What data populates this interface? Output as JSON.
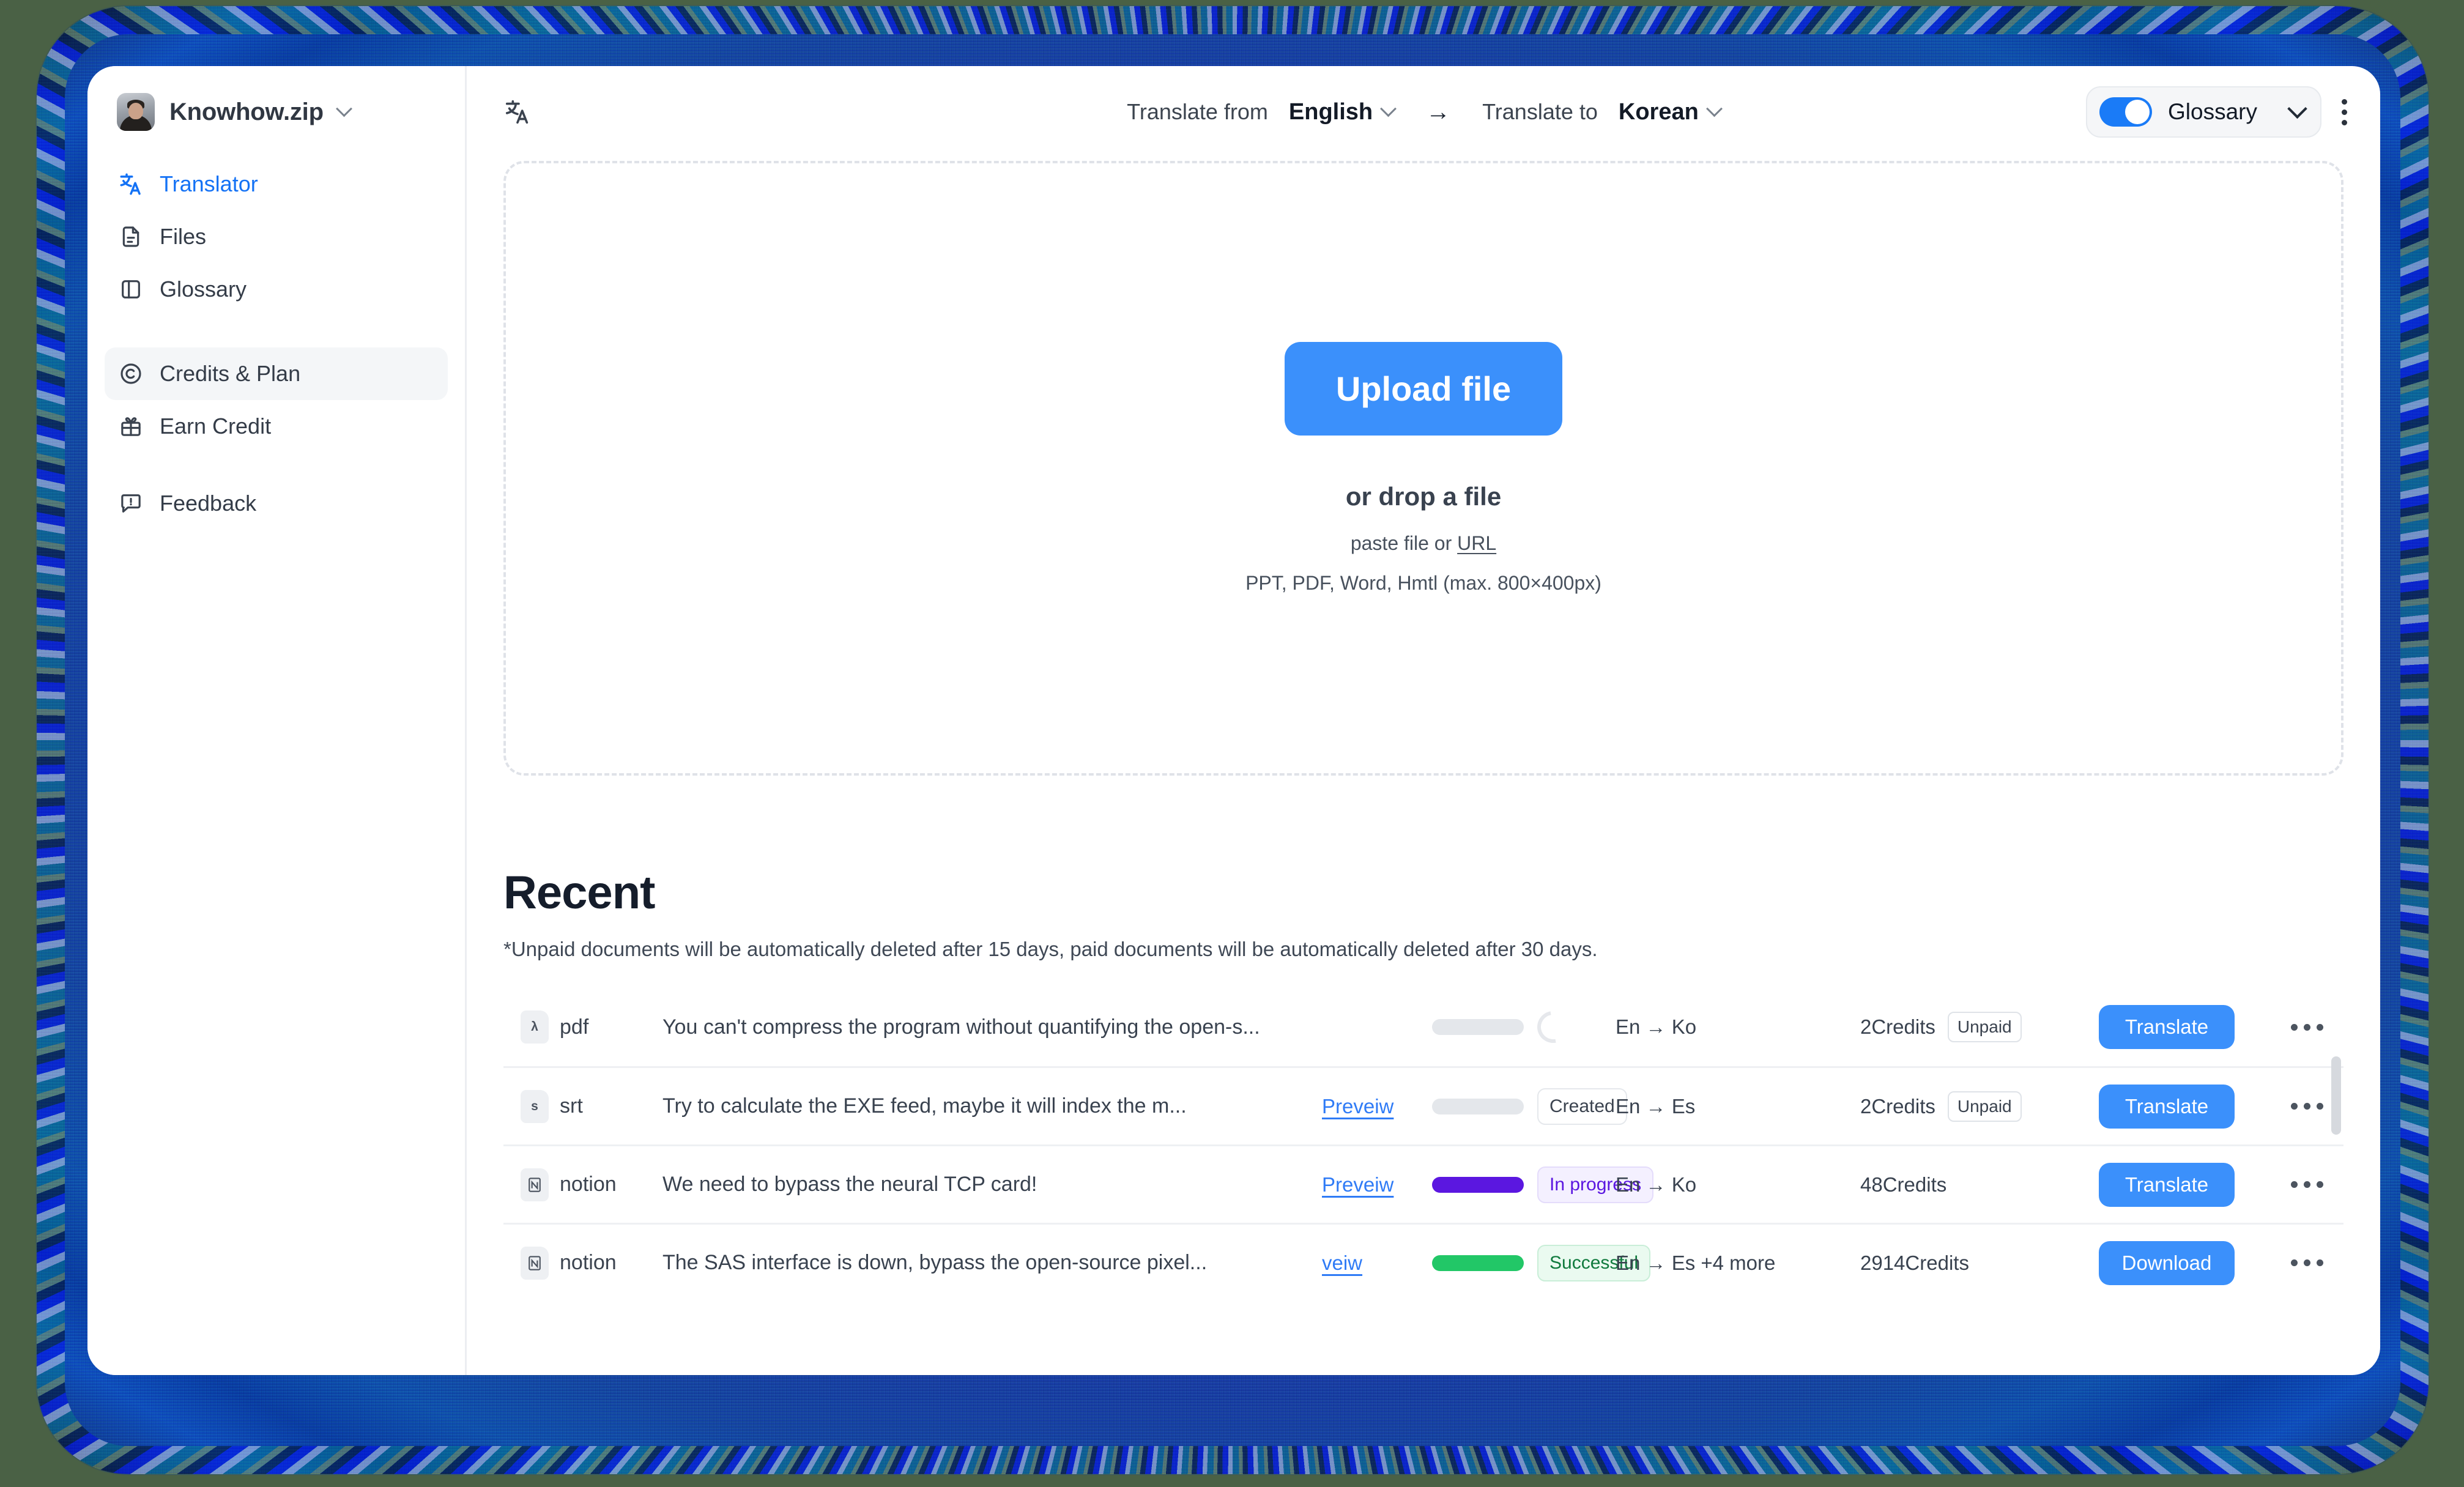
{
  "window": {
    "frame_color": "#1b3f9e"
  },
  "sidebar": {
    "brand": {
      "name": "Knowhow.zip",
      "chevron_icon": "chevron-down-icon",
      "avatar_icon": "user-avatar"
    },
    "items": [
      {
        "label": "Translator",
        "icon": "translate-icon",
        "state": "active"
      },
      {
        "label": "Files",
        "icon": "file-icon",
        "state": "default"
      },
      {
        "label": "Glossary",
        "icon": "book-panel-icon",
        "state": "default"
      },
      {
        "label": "Credits & Plan",
        "icon": "copyright-icon",
        "state": "selected"
      },
      {
        "label": "Earn Credit",
        "icon": "gift-icon",
        "state": "default"
      },
      {
        "label": "Feedback",
        "icon": "feedback-icon",
        "state": "default"
      }
    ]
  },
  "topbar": {
    "app_icon": "translate-icon",
    "translate_from_label": "Translate from",
    "source_language": "English",
    "direction_arrow": "→",
    "translate_to_label": "Translate to",
    "target_language": "Korean",
    "glossary_label": "Glossary",
    "glossary_enabled": true,
    "glossary_chevron_icon": "chevron-down-icon",
    "kebab_icon": "kebab-menu-icon",
    "accent_color": "#1a7bf7"
  },
  "dropzone": {
    "upload_button": "Upload file",
    "title": "or drop a file",
    "paste_prefix": "paste file or ",
    "paste_link": "URL",
    "formats": "PPT, PDF, Word, Hmtl (max. 800×400px)"
  },
  "recent": {
    "title": "Recent",
    "note": "*Unpaid documents will be automatically deleted after 15 days, paid documents will be automatically deleted after 30 days.",
    "rows": [
      {
        "type": "pdf",
        "type_glyph": "λ",
        "name": "You can't compress the program without quantifying the open-s...",
        "preview": "",
        "progress_pct": 0,
        "progress_color": "#e4e7eb",
        "spinner": true,
        "status": "",
        "status_kind": "none",
        "langs": "En → Ko",
        "credits": "2Credits",
        "payment": "Unpaid",
        "action": "Translate",
        "more_icon": "more-horizontal-icon"
      },
      {
        "type": "srt",
        "type_glyph": "s",
        "name": "Try to calculate the EXE feed, maybe it will index the m...",
        "preview": "Preveiw",
        "progress_pct": 0,
        "progress_color": "#e4e7eb",
        "spinner": false,
        "status": "Created",
        "status_kind": "default",
        "langs": "En → Es",
        "credits": "2Credits",
        "payment": "Unpaid",
        "action": "Translate",
        "more_icon": "more-horizontal-icon"
      },
      {
        "type": "notion",
        "type_glyph": "N",
        "name": "We need to bypass the neural TCP card!",
        "preview": "Preveiw",
        "progress_pct": 100,
        "progress_color": "#5b17e0",
        "spinner": false,
        "status": "In progress",
        "status_kind": "progress",
        "langs": "En → Ko",
        "credits": "48Credits",
        "payment": "",
        "action": "Translate",
        "more_icon": "more-horizontal-icon"
      },
      {
        "type": "notion",
        "type_glyph": "N",
        "name": "The SAS interface is down, bypass the open-source pixel...",
        "preview": "veiw",
        "progress_pct": 100,
        "progress_color": "#22c767",
        "spinner": false,
        "status": "Successful",
        "status_kind": "success",
        "langs": "En → Es +4 more",
        "credits": "2914Credits",
        "payment": "",
        "action": "Download",
        "more_icon": "more-horizontal-icon"
      }
    ]
  }
}
